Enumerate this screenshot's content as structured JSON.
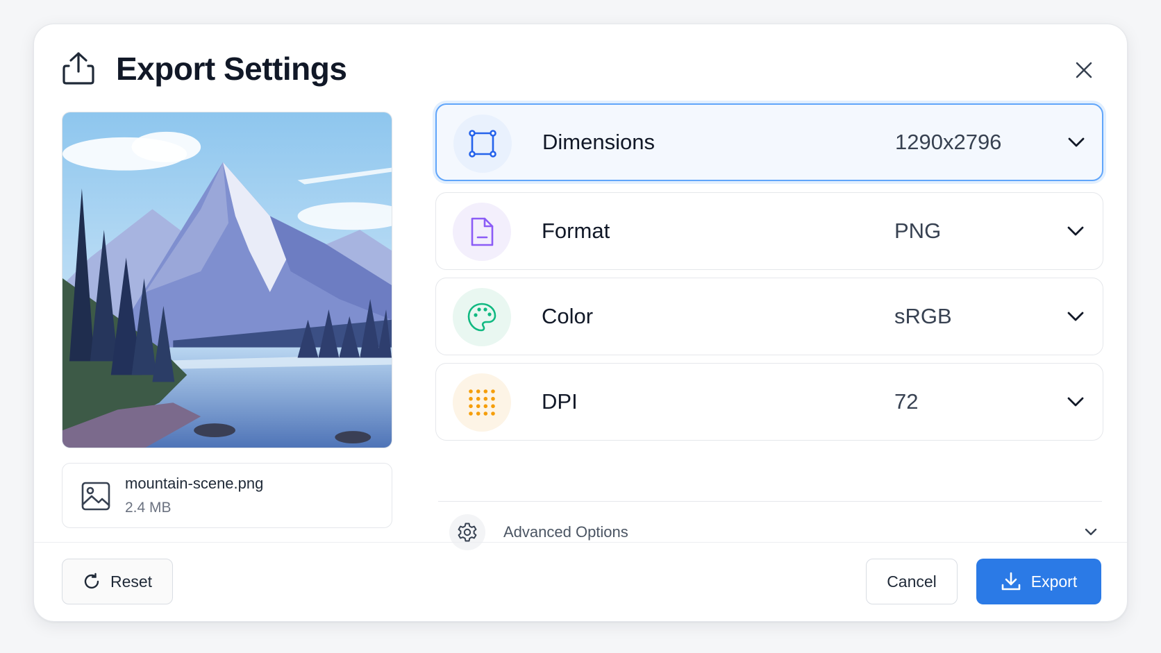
{
  "dialog": {
    "title": "Export Settings",
    "close_icon": "close-icon"
  },
  "file": {
    "name": "mountain-scene.png",
    "size": "2.4 MB"
  },
  "settings": [
    {
      "label": "Dimensions",
      "value": "1290x2796",
      "icon": "crop-frame-icon",
      "icon_color": "#2563eb",
      "bg": "#e9f1fd",
      "active": true
    },
    {
      "label": "Format",
      "value": "PNG",
      "icon": "file-icon",
      "icon_color": "#8b5cf6",
      "bg": "#f3effc"
    },
    {
      "label": "Color",
      "value": "sRGB",
      "icon": "palette-icon",
      "icon_color": "#10b981",
      "bg": "#e9f7f1"
    },
    {
      "label": "DPI",
      "value": "72",
      "icon": "dots-grid-icon",
      "icon_color": "#f59e0b",
      "bg": "#fdf4e6"
    }
  ],
  "advanced": {
    "label": "Advanced Options"
  },
  "footer": {
    "reset_label": "Reset",
    "cancel_label": "Cancel",
    "export_label": "Export"
  },
  "colors": {
    "accent": "#2b7ae6",
    "active_border": "#60a5fa"
  }
}
